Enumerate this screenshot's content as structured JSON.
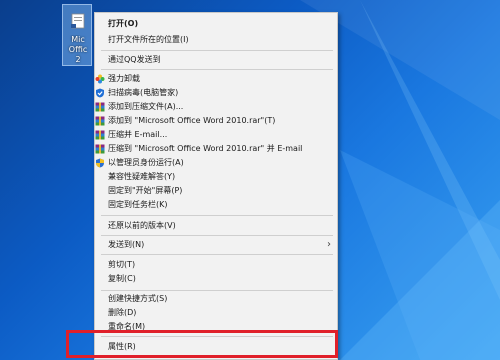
{
  "desktop_icon": {
    "label": "Mic\nOffic\n2"
  },
  "menu": {
    "items": [
      {
        "label": "打开(O)",
        "bold": true
      },
      {
        "label": "打开文件所在的位置(I)"
      },
      {
        "label": "通过QQ发送到"
      },
      {
        "label": "强力卸载",
        "icon": "flower-icon"
      },
      {
        "label": "扫描病毒(电脑管家)",
        "icon": "shield-blue-icon"
      },
      {
        "label": "添加到压缩文件(A)...",
        "icon": "winrar-icon"
      },
      {
        "label": "添加到 \"Microsoft Office Word 2010.rar\"(T)",
        "icon": "winrar-icon"
      },
      {
        "label": "压缩并 E-mail...",
        "icon": "winrar-icon"
      },
      {
        "label": "压缩到 \"Microsoft Office Word 2010.rar\" 并 E-mail",
        "icon": "winrar-icon"
      },
      {
        "label": "以管理员身份运行(A)",
        "icon": "uac-shield-icon"
      },
      {
        "label": "兼容性疑难解答(Y)"
      },
      {
        "label": "固定到\"开始\"屏幕(P)"
      },
      {
        "label": "固定到任务栏(K)"
      },
      {
        "label": "还原以前的版本(V)"
      },
      {
        "label": "发送到(N)",
        "submenu": "›"
      },
      {
        "label": "剪切(T)"
      },
      {
        "label": "复制(C)"
      },
      {
        "label": "创建快捷方式(S)"
      },
      {
        "label": "删除(D)"
      },
      {
        "label": "重命名(M)"
      },
      {
        "label": "属性(R)"
      }
    ]
  },
  "colors": {
    "highlight": "#e0202a",
    "menu_bg": "#f2f2f2",
    "desktop": "#0c5bc4"
  }
}
